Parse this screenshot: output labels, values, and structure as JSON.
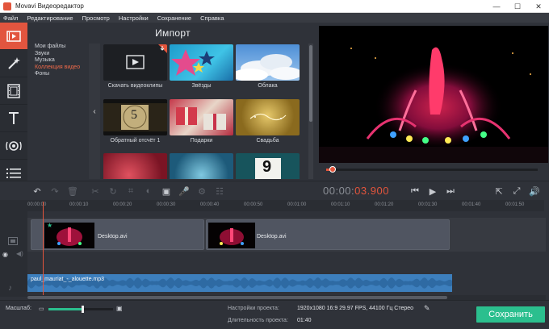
{
  "window": {
    "title": "Movavi Видеоредактор"
  },
  "menu": {
    "items": [
      "Файл",
      "Редактирование",
      "Просмотр",
      "Настройки",
      "Сохранение",
      "Справка"
    ]
  },
  "sidebar_tools": [
    "import-tool",
    "filters-tool",
    "transitions-tool",
    "titles-tool",
    "callouts-tool",
    "more-tools"
  ],
  "import_panel": {
    "heading": "Импорт",
    "categories": [
      "Мои файлы",
      "Звуки",
      "Музыка",
      "Коллекция видео",
      "Фоны"
    ],
    "selected_category": "Коллекция видео",
    "clips": [
      {
        "label": "Скачать видеоклипы",
        "number": ""
      },
      {
        "label": "Звёзды",
        "number": ""
      },
      {
        "label": "Облака",
        "number": ""
      },
      {
        "label": "Обратный отсчёт 1",
        "number": "5"
      },
      {
        "label": "Подарки",
        "number": ""
      },
      {
        "label": "Свадьба",
        "number": ""
      },
      {
        "label": "",
        "number": ""
      },
      {
        "label": "",
        "number": ""
      },
      {
        "label": "",
        "number": "9"
      }
    ]
  },
  "player": {
    "timecode_dim": "00:00:",
    "timecode_accent": "03.900",
    "progress": 0.03
  },
  "timeline": {
    "ruler": [
      "00:00:00",
      "00:00:10",
      "00:00:20",
      "00:00:30",
      "00:00:40",
      "00:00:50",
      "00:01:00",
      "00:01:10",
      "00:01:20",
      "00:01:30",
      "00:01:40",
      "00:01:50"
    ],
    "video_clips": [
      {
        "name": "Desktop.avi"
      },
      {
        "name": "Desktop.avi"
      }
    ],
    "audio_clip": "paul_mauriat_-_alouette.mp3"
  },
  "footer": {
    "scale_label": "Масштаб:",
    "scale_value": 0.52,
    "settings_label": "Настройки проекта:",
    "settings_value": "1920x1080 16:9 29.97 FPS, 44100 Гц Стерео",
    "duration_label": "Длительность проекта:",
    "duration_value": "01:40",
    "save_label": "Сохранить"
  },
  "colors": {
    "accent": "#e3553c",
    "save": "#2bbf8e",
    "audio": "#3d7fbd"
  }
}
